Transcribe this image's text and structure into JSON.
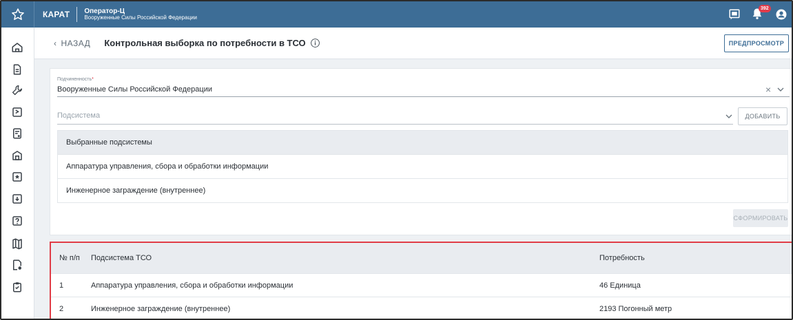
{
  "topbar": {
    "brand": "КАРАТ",
    "operator_title": "Оператор-Ц",
    "operator_org": "Вооруженные Силы Российской Федерации",
    "notification_count": "392"
  },
  "sidebar": {
    "icons": [
      "home-icon",
      "document-icon",
      "wrench-icon",
      "bookmark-icon",
      "report-icon",
      "building-icon",
      "shield-star-icon",
      "download-icon",
      "help-icon",
      "map-icon",
      "file-settings-icon",
      "clipboard-icon"
    ]
  },
  "header": {
    "back_label": "НАЗАД",
    "title": "Контрольная выборка по потребности в ТСО",
    "preview_label": "ПРЕДПРОСМОТР"
  },
  "form": {
    "subordination_label": "Подчиненность",
    "subordination_required": "*",
    "subordination_value": "Вооруженные Силы Российской Федерации",
    "subsystem_placeholder": "Подсистема",
    "add_label": "ДОБАВИТЬ",
    "selected_header": "Выбранные подсистемы",
    "selected_items": [
      "Аппаратура управления, сбора и обработки информации",
      "Инженерное заграждение (внутреннее)"
    ],
    "generate_label": "СФОРМИРОВАТЬ"
  },
  "result": {
    "col_num": "№ п/п",
    "col_name": "Подсистема ТСО",
    "col_need": "Потребность",
    "rows": [
      {
        "num": "1",
        "name": "Аппаратура управления, сбора и обработки информации",
        "need": "46 Единица"
      },
      {
        "num": "2",
        "name": "Инженерное заграждение (внутреннее)",
        "need": "2193 Погонный метр"
      }
    ]
  },
  "colors": {
    "topbar": "#3d6d96",
    "highlight_border": "#e03c46",
    "badge": "#e23c4b"
  }
}
